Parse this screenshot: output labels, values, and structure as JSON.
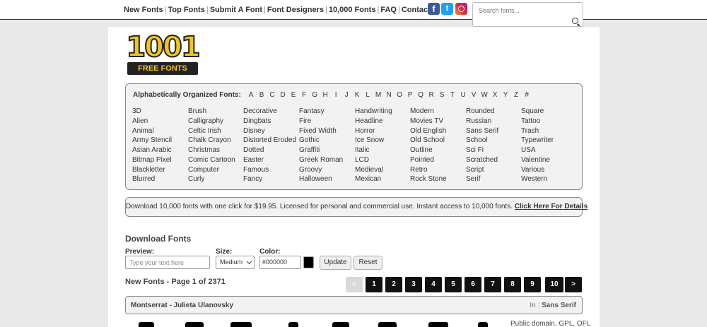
{
  "nav": {
    "items": [
      "New Fonts",
      "Top Fonts",
      "Submit A Font",
      "Font Designers",
      "10,000 Fonts",
      "FAQ",
      "Contact"
    ],
    "separator": "|"
  },
  "social": {
    "facebook": "f",
    "twitter": "t"
  },
  "search": {
    "placeholder": "Search fonts..."
  },
  "logo": {
    "number": "1001",
    "text": "FREE FONTS"
  },
  "alphabet": {
    "label": "Alphabetically Organized Fonts:",
    "letters": [
      "A",
      "B",
      "C",
      "D",
      "E",
      "F",
      "G",
      "H",
      "I",
      "J",
      "K",
      "L",
      "M",
      "N",
      "O",
      "P",
      "Q",
      "R",
      "S",
      "T",
      "U",
      "V",
      "W",
      "X",
      "Y",
      "Z",
      "#"
    ]
  },
  "categories": [
    [
      "3D",
      "Alien",
      "Animal",
      "Army Stencil",
      "Asian Arabic",
      "Bitmap Pixel",
      "Blackletter",
      "Blurred"
    ],
    [
      "Brush",
      "Calligraphy",
      "Celtic Irish",
      "Chalk Crayon",
      "Christmas",
      "Comic Cartoon",
      "Computer",
      "Curly"
    ],
    [
      "Decorative",
      "Dingbats",
      "Disney",
      "Distorted Eroded",
      "Dotted",
      "Easter",
      "Famous",
      "Fancy"
    ],
    [
      "Fantasy",
      "Fire",
      "Fixed Width",
      "Gothic",
      "Graffiti",
      "Greek Roman",
      "Groovy",
      "Halloween"
    ],
    [
      "Handwriting",
      "Headline",
      "Horror",
      "Ice Snow",
      "Italic",
      "LCD",
      "Medieval",
      "Mexican"
    ],
    [
      "Modern",
      "Movies TV",
      "Old English",
      "Old School",
      "Outline",
      "Pointed",
      "Retro",
      "Rock Stone"
    ],
    [
      "Rounded",
      "Russian",
      "Sans Serif",
      "School",
      "Sci Fi",
      "Scratched",
      "Script",
      "Serif"
    ],
    [
      "Square",
      "Tattoo",
      "Trash",
      "Typewriter",
      "USA",
      "Valentine",
      "Various",
      "Western"
    ]
  ],
  "promo": {
    "text": "Download 10,000 fonts with one click for $19.95. Licensed for personal and commercial use. Instant access to 10,000 fonts.",
    "link": "Click Here For Details"
  },
  "download": {
    "title": "Download Fonts",
    "preview_label": "Preview:",
    "preview_placeholder": "Type your text here",
    "size_label": "Size:",
    "size_value": "Medium",
    "color_label": "Color:",
    "color_value": "#000000",
    "update_label": "Update",
    "reset_label": "Reset"
  },
  "listing": {
    "title": "New Fonts - Page 1 of 2371",
    "pages": [
      "<",
      "1",
      "2",
      "3",
      "4",
      "5",
      "6",
      "7",
      "8",
      "9",
      "10",
      ">"
    ]
  },
  "font_entry": {
    "name": "Montserrat - Julieta Ulanovsky",
    "category_prefix": "In :",
    "category": "Sans Serif",
    "license": "Public domain, GPL, OFL"
  },
  "colors": {
    "accent_yellow": "#f5c518",
    "panel_bg": "#f2f2f2",
    "page_bg": "#e8e8e8",
    "pager_active": "#111111",
    "swatch": "#000000"
  }
}
